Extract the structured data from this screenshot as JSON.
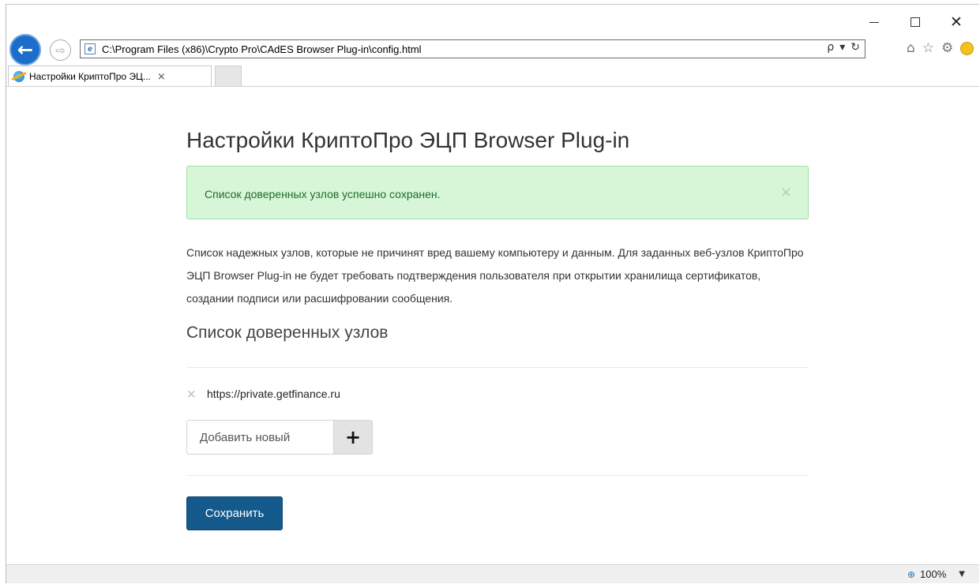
{
  "window": {
    "controls": {
      "minimize": "minimize-icon",
      "maximize": "maximize-icon",
      "close": "close-icon"
    }
  },
  "browser": {
    "address": "C:\\Program Files (x86)\\Crypto Pro\\CAdES Browser Plug-in\\config.html",
    "address_actions": {
      "search": "ρ",
      "dropdown": "▾",
      "refresh": "↻"
    },
    "tab": {
      "title": "Настройки КриптоПро ЭЦ...",
      "close": "×"
    },
    "icons": [
      "home-icon",
      "favorites-star-icon",
      "settings-gear-icon",
      "feedback-smiley-icon"
    ]
  },
  "page": {
    "title": "Настройки КриптоПро ЭЦП Browser Plug-in",
    "alert": {
      "text": "Список доверенных узлов успешно сохранен.",
      "close": "×"
    },
    "description": "Список надежных узлов, которые не причинят вред вашему компьютеру и данным. Для заданных веб-узлов КриптоПро ЭЦП Browser Plug-in не будет требовать подтверждения пользователя при открытии хранилища сертификатов, создании подписи или расшифровании сообщения.",
    "section_title": "Список доверенных узлов",
    "trusted_sites": [
      {
        "url": "https://private.getfinance.ru",
        "remove": "×"
      }
    ],
    "add_input": {
      "placeholder": "Добавить новый",
      "value": ""
    },
    "add_button": "+",
    "save_button": "Сохранить"
  },
  "statusbar": {
    "zoom": "100%"
  },
  "colors": {
    "alert_bg": "#d7f6d8",
    "alert_text": "#1e6b2a",
    "save_button": "#145a8c",
    "back_button": "#1c6ec9"
  }
}
